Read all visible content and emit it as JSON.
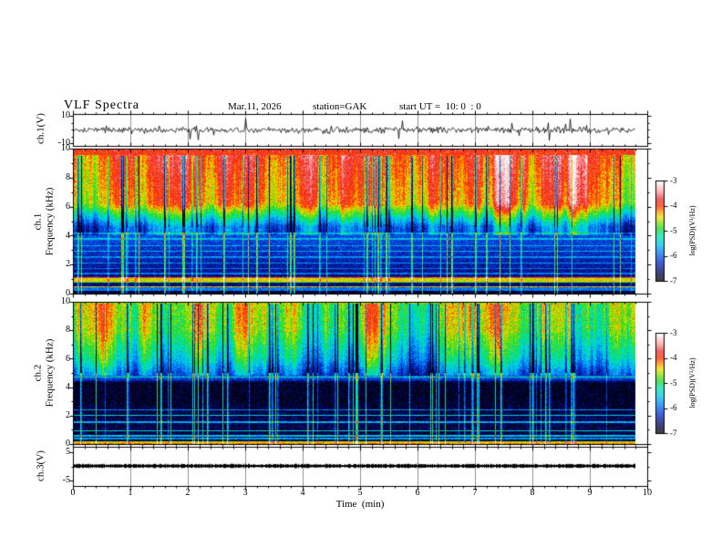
{
  "header": {
    "title": "VLF Spectra",
    "date": "Mar.11, 2026",
    "station": "station=GAK",
    "start_ut": "start UT =  10: 0  : 0"
  },
  "x_axis": {
    "label": "Time  (min)",
    "ticks": [
      "0",
      "1",
      "2",
      "3",
      "4",
      "5",
      "6",
      "7",
      "8",
      "9",
      "10"
    ],
    "range_min": [
      0,
      10
    ],
    "minor_step_min": 0.2,
    "data_end_min": 9.8
  },
  "colorbar": {
    "label": "log(PSD)(V²/Hz)",
    "ticks": [
      "-3",
      "-4",
      "-5",
      "-6",
      "-7"
    ],
    "range": [
      -7,
      -3
    ],
    "stops": [
      [
        0.0,
        "#000000"
      ],
      [
        0.06,
        "#000040"
      ],
      [
        0.18,
        "#0028c8"
      ],
      [
        0.29,
        "#0080f8"
      ],
      [
        0.37,
        "#00c8f0"
      ],
      [
        0.45,
        "#00e8a8"
      ],
      [
        0.52,
        "#18d830"
      ],
      [
        0.59,
        "#90e000"
      ],
      [
        0.64,
        "#f0e000"
      ],
      [
        0.69,
        "#ff9800"
      ],
      [
        0.75,
        "#ff3000"
      ],
      [
        0.82,
        "#e83038"
      ],
      [
        0.89,
        "#ff9898"
      ],
      [
        0.96,
        "#ffdada"
      ],
      [
        1.0,
        "#ffffff"
      ]
    ]
  },
  "chart_data": [
    {
      "id": "ch1-waveform",
      "type": "line",
      "ylabel": "ch.1(V)",
      "ylim": [
        -10,
        10
      ],
      "yticks": [
        "10",
        "-10"
      ],
      "line_color": "#000000",
      "signal": {
        "mean_V": 0,
        "sigma_V": 1.2,
        "spike_prob": 0.02,
        "spike_min_V": 3,
        "spike_max_V": 8.5
      }
    },
    {
      "id": "ch1-spectrogram",
      "type": "heatmap",
      "ylabel_line1": "ch.1",
      "ylabel_line2": "Frequency (kHz)",
      "ylim": [
        0,
        10
      ],
      "yticks": [
        "10",
        "8",
        "6",
        "4",
        "2",
        "0"
      ],
      "value_label": "log(PSD)(V²/Hz)",
      "vlim": [
        -7,
        -3
      ],
      "profile": [
        [
          0,
          -6.8
        ],
        [
          0.16,
          -6.8
        ],
        [
          0.18,
          -5.9
        ],
        [
          0.39,
          -5.9
        ],
        [
          0.41,
          -4.3
        ],
        [
          0.46,
          -4.3
        ],
        [
          0.48,
          -6.6
        ],
        [
          0.72,
          -6.6
        ],
        [
          0.74,
          -4.9
        ],
        [
          0.8,
          -4.9
        ],
        [
          0.82,
          -4.45
        ],
        [
          1.04,
          -4.45
        ],
        [
          1.06,
          -4.0
        ],
        [
          1.12,
          -4.0
        ],
        [
          1.14,
          -6.55
        ],
        [
          4.6,
          -5.95
        ],
        [
          6.2,
          -4.25
        ],
        [
          9.0,
          -4.0
        ],
        [
          10,
          -3.85
        ]
      ],
      "hlines": [
        [
          1.35,
          0.6
        ],
        [
          1.7,
          0.5
        ],
        [
          2.1,
          0.6
        ],
        [
          2.5,
          0.5
        ],
        [
          2.9,
          0.6
        ],
        [
          3.3,
          0.5
        ],
        [
          3.75,
          0.5
        ],
        [
          4.15,
          0.45
        ]
      ],
      "columns": {
        "smooth_amp": 0.55,
        "smooth_zone": [
          4.0,
          9.6
        ],
        "impulse_prob": 0.1,
        "impulse_dark": 1.6,
        "impulse_dark_zone": [
          4.2,
          9.5
        ],
        "impulse_bright": 1.1,
        "impulse_bright_zone": [
          0,
          4.6
        ],
        "speckle": 0.28,
        "hot_zone": 9.3,
        "hot_prob": 0.02,
        "hot_v": -3.3
      }
    },
    {
      "id": "ch2-spectrogram",
      "type": "heatmap",
      "ylabel_line1": "ch.2",
      "ylabel_line2": "Frequency (kHz)",
      "ylim": [
        0,
        10
      ],
      "yticks": [
        "10",
        "8",
        "6",
        "4",
        "2",
        "0"
      ],
      "value_label": "log(PSD)(V²/Hz)",
      "vlim": [
        -7,
        -3
      ],
      "profile": [
        [
          0,
          -4.15
        ],
        [
          0.05,
          -4.15
        ],
        [
          0.07,
          -4.55
        ],
        [
          0.15,
          -4.55
        ],
        [
          0.17,
          -6.75
        ],
        [
          2.0,
          -6.7
        ],
        [
          3.0,
          -6.85
        ],
        [
          4.3,
          -6.85
        ],
        [
          4.55,
          -6.15
        ],
        [
          6.0,
          -5.35
        ],
        [
          8.0,
          -4.75
        ],
        [
          10,
          -4.6
        ]
      ],
      "hlines": [
        [
          0.35,
          1.0
        ],
        [
          0.55,
          1.2
        ],
        [
          0.9,
          1.3
        ],
        [
          1.5,
          1.05
        ],
        [
          2.0,
          1.25
        ],
        [
          2.4,
          0.95
        ],
        [
          4.7,
          0.85
        ]
      ],
      "columns": {
        "smooth_amp": 0.5,
        "smooth_zone": [
          4.8,
          9.9
        ],
        "impulse_prob": 0.09,
        "impulse_dark": 1.3,
        "impulse_dark_zone": [
          5.0,
          9.9
        ],
        "impulse_bright": 1.05,
        "impulse_bright_zone": [
          0,
          5.0
        ],
        "speckle": 0.3,
        "hot_zone": 7.8,
        "hot_prob": 0.008,
        "hot_v": -4.05
      }
    },
    {
      "id": "ch3-waveform",
      "type": "line",
      "ylabel": "ch.3(V)",
      "ylim": [
        -5,
        5
      ],
      "yticks": [
        "5",
        "-5"
      ],
      "line_color": "#000000",
      "signal": {
        "level_V": 0.3,
        "thickness_V": 1.1
      }
    }
  ],
  "render_seed": 1234567
}
